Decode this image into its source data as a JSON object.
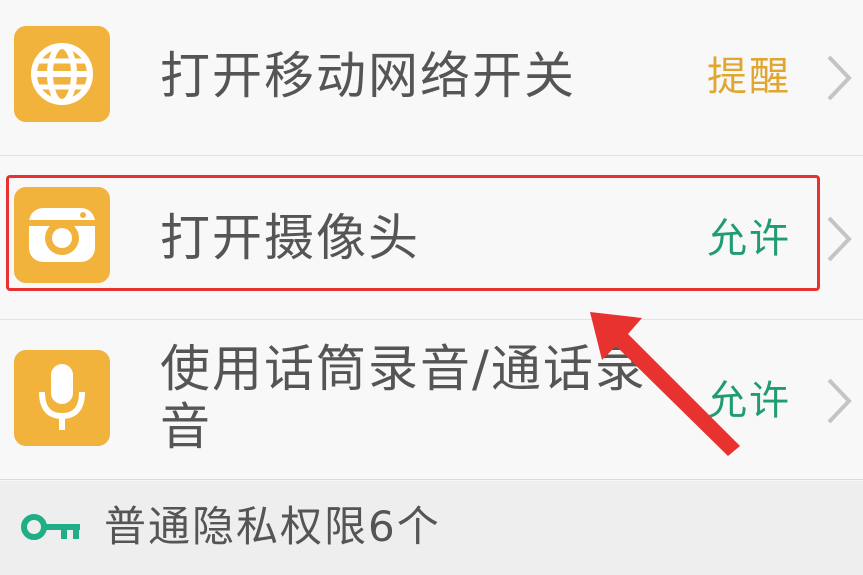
{
  "permissions": [
    {
      "icon": "globe-icon",
      "label": "打开移动网络开关",
      "status": "提醒"
    },
    {
      "icon": "camera-icon",
      "label": "打开摄像头",
      "status": "允许"
    },
    {
      "icon": "microphone-icon",
      "label": "使用话筒录音/通话录音",
      "status": "允许"
    }
  ],
  "footer": {
    "icon": "key-icon",
    "text": "普通隐私权限6个"
  },
  "colors": {
    "icon_tile": "#f2b33d",
    "status_remind": "#e0a630",
    "status_allow": "#1f9c72",
    "highlight": "#e8322f",
    "key_icon": "#1fae86"
  }
}
